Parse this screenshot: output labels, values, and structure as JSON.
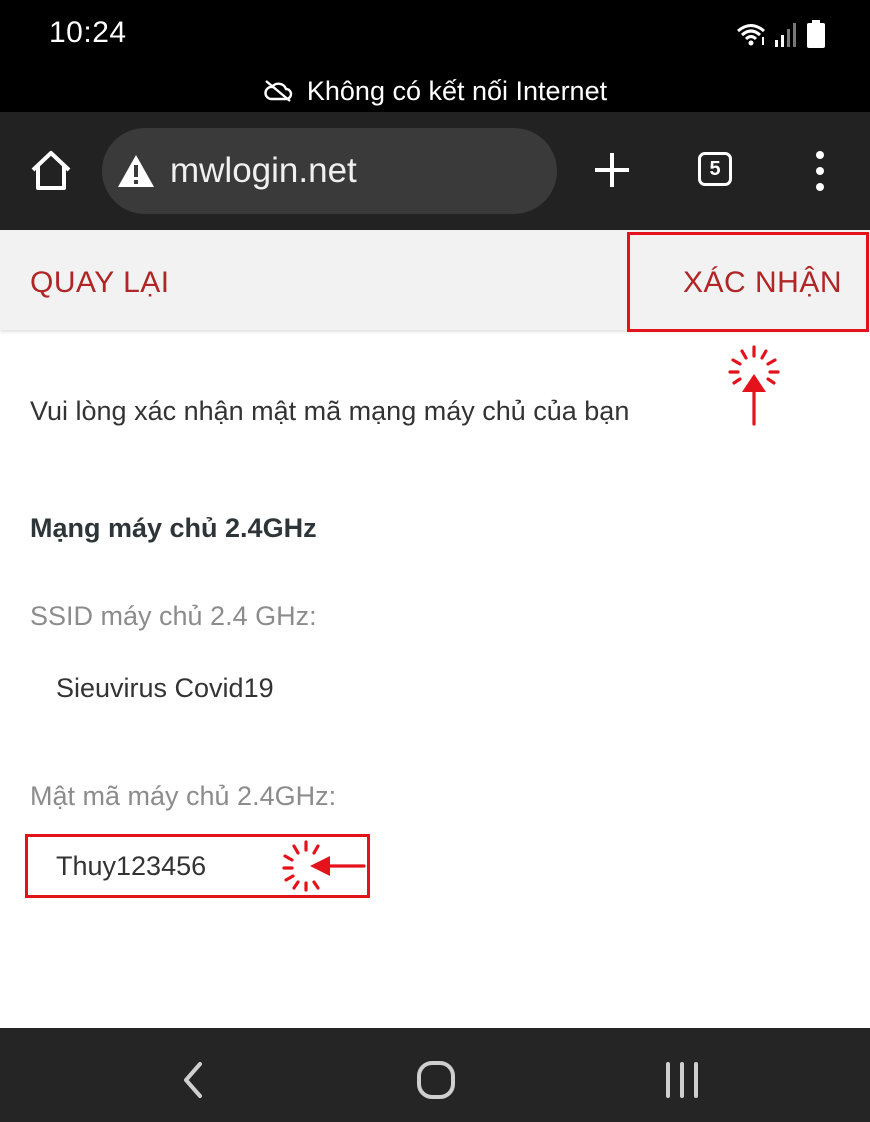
{
  "status_bar": {
    "time": "10:24",
    "icons": [
      "wifi-icon",
      "signal-icon",
      "battery-icon"
    ]
  },
  "offline_banner": {
    "text": "Không có kết nối Internet",
    "icon": "cloud-off-icon"
  },
  "browser": {
    "url": "mwlogin.net",
    "tab_count": "5",
    "icons": [
      "home-icon",
      "warning-icon",
      "plus-icon",
      "tabs-icon",
      "more-vert-icon"
    ]
  },
  "header": {
    "back_label": "QUAY LẠI",
    "confirm_label": "XÁC NHẬN"
  },
  "content": {
    "instruction": "Vui lòng xác nhận mật mã mạng máy chủ của bạn",
    "section_title": "Mạng máy chủ 2.4GHz",
    "ssid_label": "SSID máy chủ 2.4 GHz:",
    "ssid_value": "Sieuvirus Covid19",
    "password_label": "Mật mã máy chủ 2.4GHz:",
    "password_value": "Thuy123456"
  },
  "colors": {
    "accent": "#b02525",
    "annotation": "#e3121b",
    "toolbar": "#222222",
    "header_bg": "#f2f2f2"
  }
}
